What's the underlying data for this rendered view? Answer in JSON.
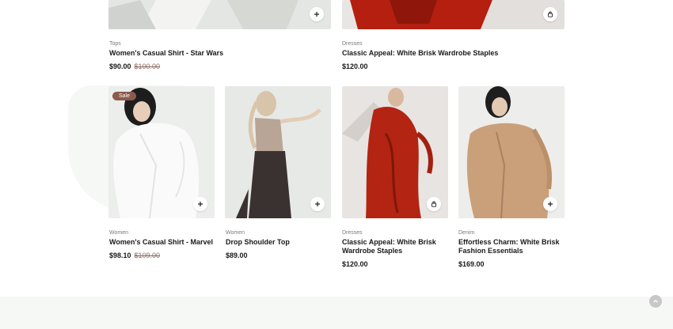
{
  "products_top": [
    {
      "category": "Tops",
      "title": "Women's Casual Shirt - Star Wars",
      "price": "$90.00",
      "old_price": "$100.00",
      "action": "add"
    },
    {
      "category": "Dresses",
      "title": "Classic Appeal: White Brisk Wardrobe Staples",
      "price": "$120.00",
      "old_price": "",
      "action": "bag"
    }
  ],
  "products": [
    {
      "category": "Women",
      "title": "Women's Casual Shirt - Marvel",
      "price": "$98.10",
      "old_price": "$109.00",
      "badge": "Sale",
      "action": "add"
    },
    {
      "category": "Women",
      "title": "Drop Shoulder Top",
      "price": "$89.00",
      "old_price": "",
      "action": "add"
    },
    {
      "category": "Dresses",
      "title": "Classic Appeal: White Brisk Wardrobe Staples",
      "price": "$120.00",
      "old_price": "",
      "action": "bag"
    },
    {
      "category": "Denim",
      "title": "Effortless Charm: White Brisk Fashion Essentials",
      "price": "$169.00",
      "old_price": "",
      "action": "add"
    }
  ],
  "icons": {
    "add": "plus-icon",
    "bag": "shopping-bag-icon",
    "scroll_top": "chevron-up-icon"
  },
  "colors": {
    "sale_badge": "#8a5a4c",
    "old_price": "#8a6a60",
    "footer": "#f6f8f6"
  }
}
